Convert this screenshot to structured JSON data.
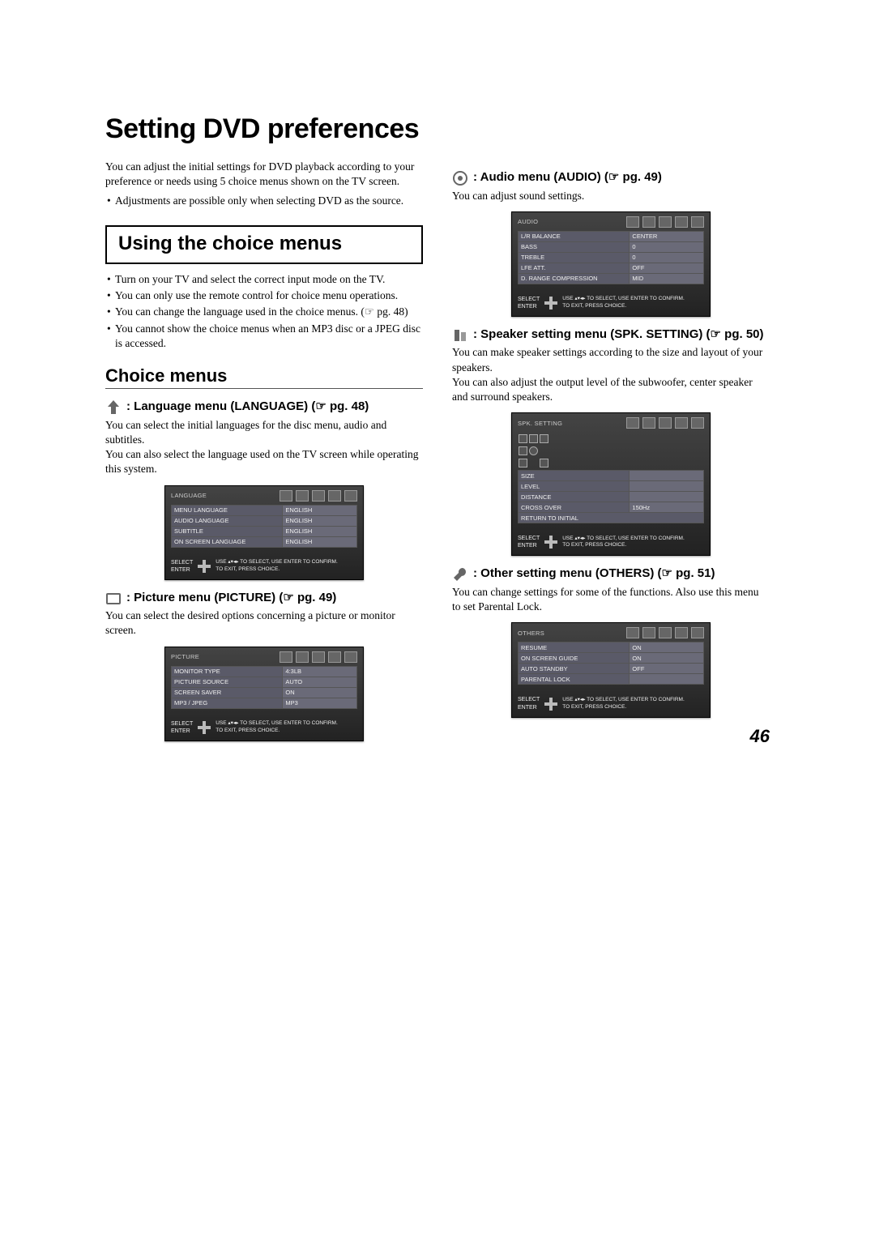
{
  "pageTitle": "Setting DVD preferences",
  "pageNumber": "46",
  "intro": "You can adjust the initial settings for DVD playback according to your preference or needs using 5 choice menus shown on the TV screen.",
  "introBullet": "Adjustments are possible only when selecting DVD as the source.",
  "boxHeading": "Using the choice menus",
  "usingBullets": [
    "Turn on your TV and select the correct input mode on the TV.",
    "You can only use the remote control for choice menu operations.",
    "You can change the language used in the choice menus. (☞ pg. 48)",
    "You cannot show the choice menus when an MP3 disc or a JPEG disc is accessed."
  ],
  "choiceHeading": "Choice menus",
  "hintSelect": "SELECT",
  "hintEnter": "ENTER",
  "hintText1": "USE ▴▾◂▸ TO SELECT, USE ENTER TO CONFIRM.",
  "hintText2": "TO EXIT, PRESS CHOICE.",
  "lang": {
    "heading": ": Language menu (LANGUAGE) (☞ pg. 48)",
    "desc1": "You can select the initial languages for the disc menu, audio and subtitles.",
    "desc2": "You can also select the language used on the TV screen while operating this system.",
    "osdTitle": "LANGUAGE",
    "rows": [
      [
        "MENU LANGUAGE",
        "ENGLISH"
      ],
      [
        "AUDIO LANGUAGE",
        "ENGLISH"
      ],
      [
        "SUBTITLE",
        "ENGLISH"
      ],
      [
        "ON SCREEN LANGUAGE",
        "ENGLISH"
      ]
    ]
  },
  "picture": {
    "heading": ": Picture menu (PICTURE) (☞ pg. 49)",
    "desc1": "You can select the desired options concerning a picture or monitor screen.",
    "osdTitle": "PICTURE",
    "rows": [
      [
        "MONITOR TYPE",
        "4:3LB"
      ],
      [
        "PICTURE SOURCE",
        "AUTO"
      ],
      [
        "SCREEN SAVER",
        "ON"
      ],
      [
        "MP3 / JPEG",
        "MP3"
      ]
    ]
  },
  "audio": {
    "heading": ": Audio menu (AUDIO) (☞ pg. 49)",
    "desc1": "You can adjust sound settings.",
    "osdTitle": "AUDIO",
    "rows": [
      [
        "L/R BALANCE",
        "CENTER"
      ],
      [
        "BASS",
        "0"
      ],
      [
        "TREBLE",
        "0"
      ],
      [
        "LFE ATT.",
        "OFF"
      ],
      [
        "D. RANGE COMPRESSION",
        "MID"
      ]
    ]
  },
  "spk": {
    "heading": ": Speaker setting menu (SPK. SETTING) (☞ pg. 50)",
    "desc1": "You can make speaker settings according to the size and layout of your speakers.",
    "desc2": "You can also adjust the output level of the subwoofer, center speaker and surround speakers.",
    "osdTitle": "SPK. SETTING",
    "rows": [
      [
        "SIZE",
        ""
      ],
      [
        "LEVEL",
        ""
      ],
      [
        "DISTANCE",
        ""
      ],
      [
        "CROSS OVER",
        "150Hz"
      ],
      [
        "RETURN TO INITIAL",
        ""
      ]
    ]
  },
  "others": {
    "heading": ": Other setting menu (OTHERS) (☞ pg. 51)",
    "desc1": "You can change settings for some of the functions. Also use this menu to set Parental Lock.",
    "osdTitle": "OTHERS",
    "rows": [
      [
        "RESUME",
        "ON"
      ],
      [
        "ON SCREEN GUIDE",
        "ON"
      ],
      [
        "AUTO STANDBY",
        "OFF"
      ],
      [
        "PARENTAL LOCK",
        ""
      ]
    ]
  }
}
